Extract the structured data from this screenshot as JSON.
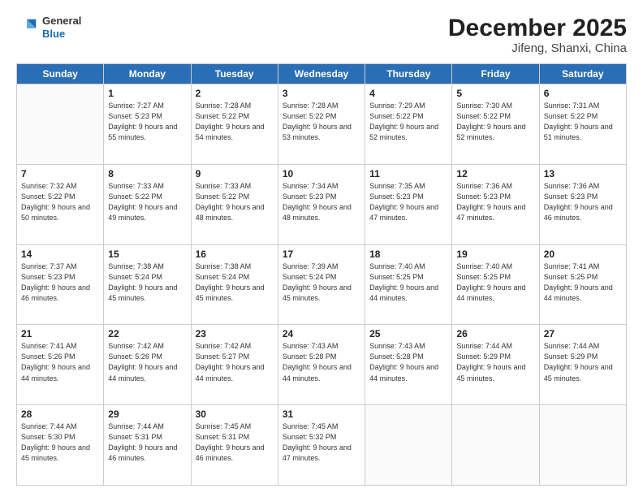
{
  "header": {
    "logo": {
      "general": "General",
      "blue": "Blue"
    },
    "title": "December 2025",
    "location": "Jifeng, Shanxi, China"
  },
  "days_of_week": [
    "Sunday",
    "Monday",
    "Tuesday",
    "Wednesday",
    "Thursday",
    "Friday",
    "Saturday"
  ],
  "weeks": [
    [
      {
        "day": "",
        "sunrise": "",
        "sunset": "",
        "daylight": ""
      },
      {
        "day": "1",
        "sunrise": "Sunrise: 7:27 AM",
        "sunset": "Sunset: 5:23 PM",
        "daylight": "Daylight: 9 hours and 55 minutes."
      },
      {
        "day": "2",
        "sunrise": "Sunrise: 7:28 AM",
        "sunset": "Sunset: 5:22 PM",
        "daylight": "Daylight: 9 hours and 54 minutes."
      },
      {
        "day": "3",
        "sunrise": "Sunrise: 7:28 AM",
        "sunset": "Sunset: 5:22 PM",
        "daylight": "Daylight: 9 hours and 53 minutes."
      },
      {
        "day": "4",
        "sunrise": "Sunrise: 7:29 AM",
        "sunset": "Sunset: 5:22 PM",
        "daylight": "Daylight: 9 hours and 52 minutes."
      },
      {
        "day": "5",
        "sunrise": "Sunrise: 7:30 AM",
        "sunset": "Sunset: 5:22 PM",
        "daylight": "Daylight: 9 hours and 52 minutes."
      },
      {
        "day": "6",
        "sunrise": "Sunrise: 7:31 AM",
        "sunset": "Sunset: 5:22 PM",
        "daylight": "Daylight: 9 hours and 51 minutes."
      }
    ],
    [
      {
        "day": "7",
        "sunrise": "Sunrise: 7:32 AM",
        "sunset": "Sunset: 5:22 PM",
        "daylight": "Daylight: 9 hours and 50 minutes."
      },
      {
        "day": "8",
        "sunrise": "Sunrise: 7:33 AM",
        "sunset": "Sunset: 5:22 PM",
        "daylight": "Daylight: 9 hours and 49 minutes."
      },
      {
        "day": "9",
        "sunrise": "Sunrise: 7:33 AM",
        "sunset": "Sunset: 5:22 PM",
        "daylight": "Daylight: 9 hours and 48 minutes."
      },
      {
        "day": "10",
        "sunrise": "Sunrise: 7:34 AM",
        "sunset": "Sunset: 5:23 PM",
        "daylight": "Daylight: 9 hours and 48 minutes."
      },
      {
        "day": "11",
        "sunrise": "Sunrise: 7:35 AM",
        "sunset": "Sunset: 5:23 PM",
        "daylight": "Daylight: 9 hours and 47 minutes."
      },
      {
        "day": "12",
        "sunrise": "Sunrise: 7:36 AM",
        "sunset": "Sunset: 5:23 PM",
        "daylight": "Daylight: 9 hours and 47 minutes."
      },
      {
        "day": "13",
        "sunrise": "Sunrise: 7:36 AM",
        "sunset": "Sunset: 5:23 PM",
        "daylight": "Daylight: 9 hours and 46 minutes."
      }
    ],
    [
      {
        "day": "14",
        "sunrise": "Sunrise: 7:37 AM",
        "sunset": "Sunset: 5:23 PM",
        "daylight": "Daylight: 9 hours and 46 minutes."
      },
      {
        "day": "15",
        "sunrise": "Sunrise: 7:38 AM",
        "sunset": "Sunset: 5:24 PM",
        "daylight": "Daylight: 9 hours and 45 minutes."
      },
      {
        "day": "16",
        "sunrise": "Sunrise: 7:38 AM",
        "sunset": "Sunset: 5:24 PM",
        "daylight": "Daylight: 9 hours and 45 minutes."
      },
      {
        "day": "17",
        "sunrise": "Sunrise: 7:39 AM",
        "sunset": "Sunset: 5:24 PM",
        "daylight": "Daylight: 9 hours and 45 minutes."
      },
      {
        "day": "18",
        "sunrise": "Sunrise: 7:40 AM",
        "sunset": "Sunset: 5:25 PM",
        "daylight": "Daylight: 9 hours and 44 minutes."
      },
      {
        "day": "19",
        "sunrise": "Sunrise: 7:40 AM",
        "sunset": "Sunset: 5:25 PM",
        "daylight": "Daylight: 9 hours and 44 minutes."
      },
      {
        "day": "20",
        "sunrise": "Sunrise: 7:41 AM",
        "sunset": "Sunset: 5:25 PM",
        "daylight": "Daylight: 9 hours and 44 minutes."
      }
    ],
    [
      {
        "day": "21",
        "sunrise": "Sunrise: 7:41 AM",
        "sunset": "Sunset: 5:26 PM",
        "daylight": "Daylight: 9 hours and 44 minutes."
      },
      {
        "day": "22",
        "sunrise": "Sunrise: 7:42 AM",
        "sunset": "Sunset: 5:26 PM",
        "daylight": "Daylight: 9 hours and 44 minutes."
      },
      {
        "day": "23",
        "sunrise": "Sunrise: 7:42 AM",
        "sunset": "Sunset: 5:27 PM",
        "daylight": "Daylight: 9 hours and 44 minutes."
      },
      {
        "day": "24",
        "sunrise": "Sunrise: 7:43 AM",
        "sunset": "Sunset: 5:28 PM",
        "daylight": "Daylight: 9 hours and 44 minutes."
      },
      {
        "day": "25",
        "sunrise": "Sunrise: 7:43 AM",
        "sunset": "Sunset: 5:28 PM",
        "daylight": "Daylight: 9 hours and 44 minutes."
      },
      {
        "day": "26",
        "sunrise": "Sunrise: 7:44 AM",
        "sunset": "Sunset: 5:29 PM",
        "daylight": "Daylight: 9 hours and 45 minutes."
      },
      {
        "day": "27",
        "sunrise": "Sunrise: 7:44 AM",
        "sunset": "Sunset: 5:29 PM",
        "daylight": "Daylight: 9 hours and 45 minutes."
      }
    ],
    [
      {
        "day": "28",
        "sunrise": "Sunrise: 7:44 AM",
        "sunset": "Sunset: 5:30 PM",
        "daylight": "Daylight: 9 hours and 45 minutes."
      },
      {
        "day": "29",
        "sunrise": "Sunrise: 7:44 AM",
        "sunset": "Sunset: 5:31 PM",
        "daylight": "Daylight: 9 hours and 46 minutes."
      },
      {
        "day": "30",
        "sunrise": "Sunrise: 7:45 AM",
        "sunset": "Sunset: 5:31 PM",
        "daylight": "Daylight: 9 hours and 46 minutes."
      },
      {
        "day": "31",
        "sunrise": "Sunrise: 7:45 AM",
        "sunset": "Sunset: 5:32 PM",
        "daylight": "Daylight: 9 hours and 47 minutes."
      },
      {
        "day": "",
        "sunrise": "",
        "sunset": "",
        "daylight": ""
      },
      {
        "day": "",
        "sunrise": "",
        "sunset": "",
        "daylight": ""
      },
      {
        "day": "",
        "sunrise": "",
        "sunset": "",
        "daylight": ""
      }
    ]
  ]
}
